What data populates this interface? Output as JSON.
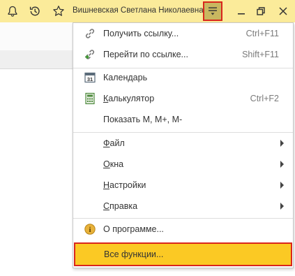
{
  "topbar": {
    "user_name": "Вишневская Светлана Николаевна",
    "icons": [
      "bell-icon",
      "history-icon",
      "star-icon",
      "main-menu-icon",
      "minimize-icon",
      "restore-icon",
      "close-icon"
    ]
  },
  "menu": {
    "items": [
      {
        "label": "Получить ссылку...",
        "shortcut": "Ctrl+F11",
        "icon": "link-icon"
      },
      {
        "label": "Перейти по ссылке...",
        "shortcut": "Shift+F11",
        "icon": "follow-link-icon"
      },
      {
        "label": "Календарь",
        "icon": "calendar-icon",
        "icon_text": "31"
      },
      {
        "label_underlined": "К",
        "label_rest": "алькулятор",
        "shortcut": "Ctrl+F2",
        "icon": "calculator-icon"
      },
      {
        "label": "Показать М, М+, М-"
      },
      {
        "label_underlined": "Ф",
        "label_rest": "айл",
        "submenu": true
      },
      {
        "label_underlined": "О",
        "label_rest": "кна",
        "submenu": true
      },
      {
        "label_underlined": "Н",
        "label_rest": "астройки",
        "submenu": true
      },
      {
        "label_underlined": "С",
        "label_rest": "правка",
        "submenu": true
      },
      {
        "label": "О программе...",
        "icon": "info-icon",
        "icon_text": "i"
      },
      {
        "label": "Все функции..."
      }
    ]
  },
  "colors": {
    "topbar_bg": "#fbeb9a",
    "highlight_bg": "#fbc924",
    "highlight_border": "#d9261c"
  }
}
